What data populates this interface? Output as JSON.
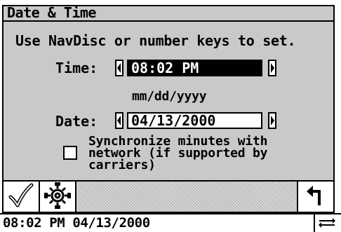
{
  "window": {
    "title": "Date & Time"
  },
  "instructions": {
    "text": "Use NavDisc or number keys to set."
  },
  "time": {
    "label": "Time:",
    "value": "08:02 PM"
  },
  "date": {
    "format_hint": "mm/dd/yyyy",
    "label": "Date:",
    "value": "04/13/2000"
  },
  "sync": {
    "label": "Synchronize minutes with network (if supported by carriers)",
    "checked": false
  },
  "toolbar": {
    "ok_icon": "checkmark-icon",
    "settings_icon": "gear-icon",
    "back_icon": "return-arrow-icon"
  },
  "status": {
    "text": "08:02 PM 04/13/2000",
    "network_icon": "network-transfer-icon"
  },
  "colors": {
    "background": "#ffffff",
    "panel": "#c9c9c9",
    "text": "#000000",
    "selected_field": "#000000"
  }
}
